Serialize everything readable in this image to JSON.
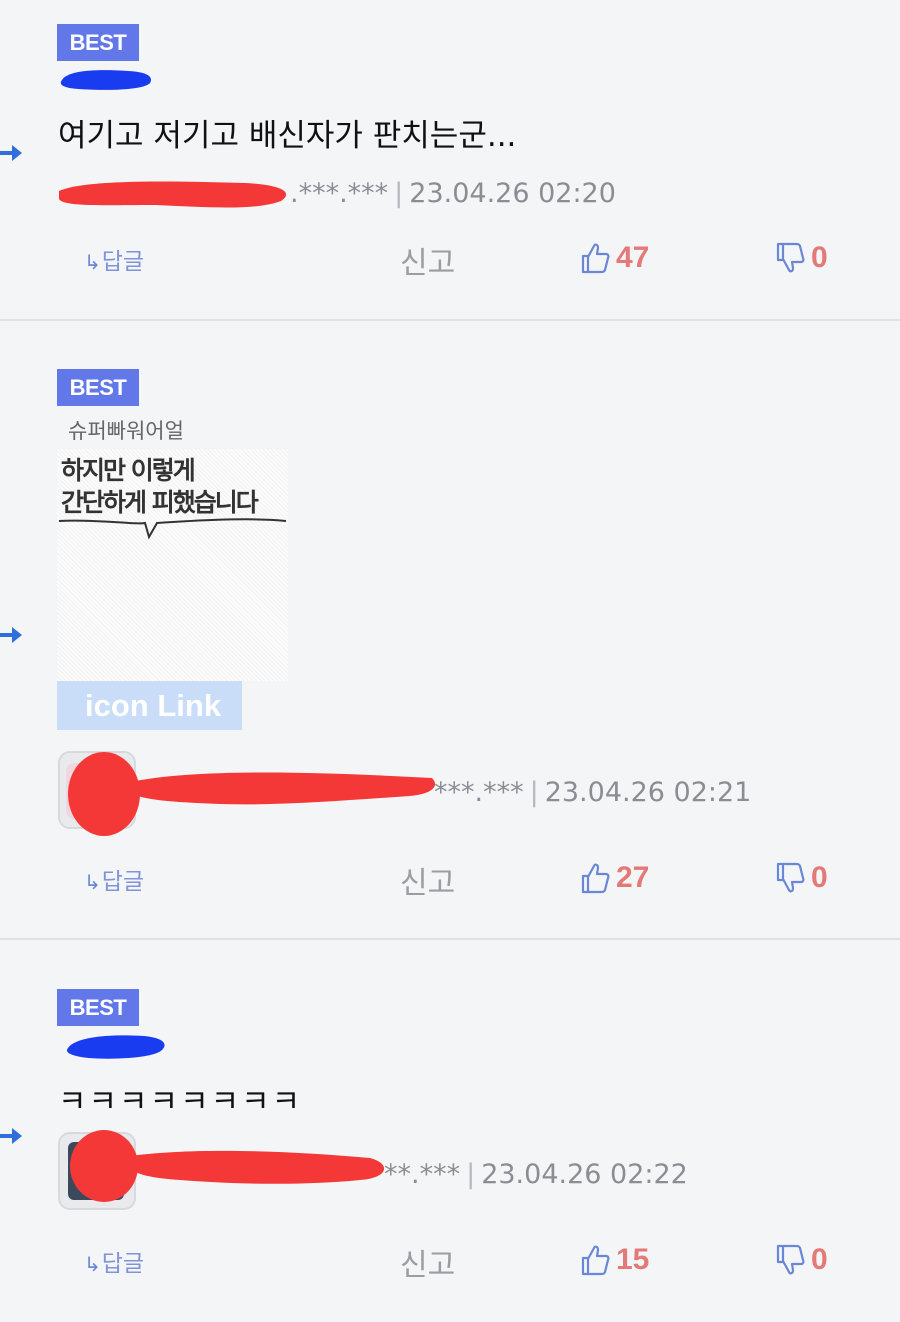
{
  "comments": [
    {
      "badge": "BEST",
      "body": "여기고 저기고 배신자가 판치는군...",
      "ip_visible": ".***.***",
      "date": "23.04.26 02:20",
      "reply_label": "답글",
      "report_label": "신고",
      "likes": "47",
      "dislikes": "0"
    },
    {
      "badge": "BEST",
      "nickname": "슈퍼빠워어얼",
      "image_text_line1": "하지만 이렇게",
      "image_text_line2": "간단하게 피했습니다",
      "link_label": "icon Link",
      "ip_visible": "***.***",
      "date": "23.04.26 02:21",
      "reply_label": "답글",
      "report_label": "신고",
      "likes": "27",
      "dislikes": "0"
    },
    {
      "badge": "BEST",
      "body": "ㅋㅋㅋㅋㅋㅋㅋㅋ",
      "ip_visible": "**.***",
      "date": "23.04.26 02:22",
      "reply_label": "답글",
      "report_label": "신고",
      "likes": "15",
      "dislikes": "0"
    }
  ],
  "colors": {
    "badge": "#6277e8",
    "like_count": "#e47a77",
    "icon_blue": "#6a86d6",
    "redaction_red": "#f43838",
    "redaction_blue": "#1a3cf0"
  }
}
